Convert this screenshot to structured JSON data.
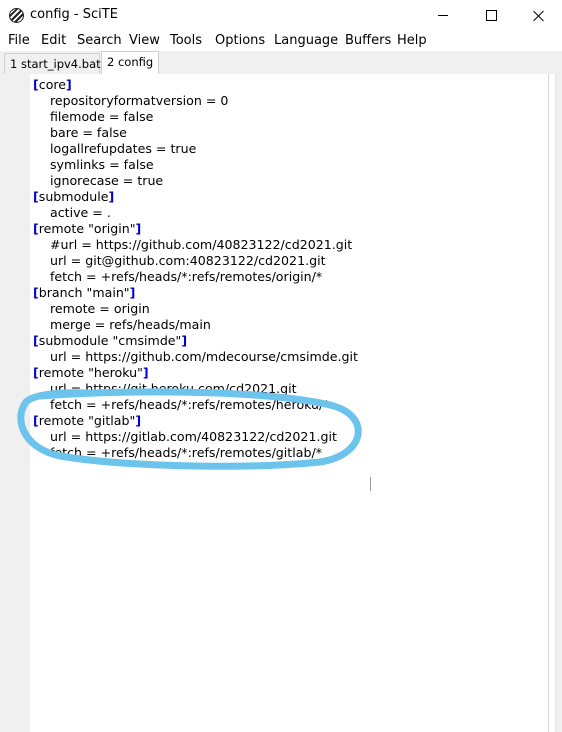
{
  "window": {
    "title": "config - SciTE",
    "icon": "scite-icon"
  },
  "menu": [
    "File",
    "Edit",
    "Search",
    "View",
    "Tools",
    "Options",
    "Language",
    "Buffers",
    "Help"
  ],
  "tabs": [
    {
      "label": "1 start_ipv4.bat",
      "active": false
    },
    {
      "label": "2 config",
      "active": true
    }
  ],
  "editor": {
    "lines": [
      {
        "kind": "section",
        "text": "core"
      },
      {
        "kind": "kv",
        "text": "repositoryformatversion = 0"
      },
      {
        "kind": "kv",
        "text": "filemode = false"
      },
      {
        "kind": "kv",
        "text": "bare = false"
      },
      {
        "kind": "kv",
        "text": "logallrefupdates = true"
      },
      {
        "kind": "kv",
        "text": "symlinks = false"
      },
      {
        "kind": "kv",
        "text": "ignorecase = true"
      },
      {
        "kind": "section",
        "text": "submodule"
      },
      {
        "kind": "kv",
        "text": "active = ."
      },
      {
        "kind": "section",
        "text": "remote \"origin\""
      },
      {
        "kind": "kv",
        "text": "#url = https://github.com/40823122/cd2021.git"
      },
      {
        "kind": "kv",
        "text": "url = git@github.com:40823122/cd2021.git"
      },
      {
        "kind": "kv",
        "text": "fetch = +refs/heads/*:refs/remotes/origin/*"
      },
      {
        "kind": "section",
        "text": "branch \"main\""
      },
      {
        "kind": "kv",
        "text": "remote = origin"
      },
      {
        "kind": "kv",
        "text": "merge = refs/heads/main"
      },
      {
        "kind": "section",
        "text": "submodule \"cmsimde\""
      },
      {
        "kind": "kv",
        "text": "url = https://github.com/mdecourse/cmsimde.git"
      },
      {
        "kind": "section",
        "text": "remote \"heroku\""
      },
      {
        "kind": "kv",
        "text": "url = https://git.heroku.com/cd2021.git"
      },
      {
        "kind": "kv",
        "text": "fetch = +refs/heads/*:refs/remotes/heroku/*"
      },
      {
        "kind": "section",
        "text": "remote \"gitlab\""
      },
      {
        "kind": "kv",
        "text": "url = https://gitlab.com/40823122/cd2021.git"
      },
      {
        "kind": "kv",
        "text": "fetch = +refs/heads/*:refs/remotes/gitlab/*"
      }
    ]
  },
  "colors": {
    "section_bracket": "#0000cc",
    "annotation": "#6cc3ec"
  }
}
